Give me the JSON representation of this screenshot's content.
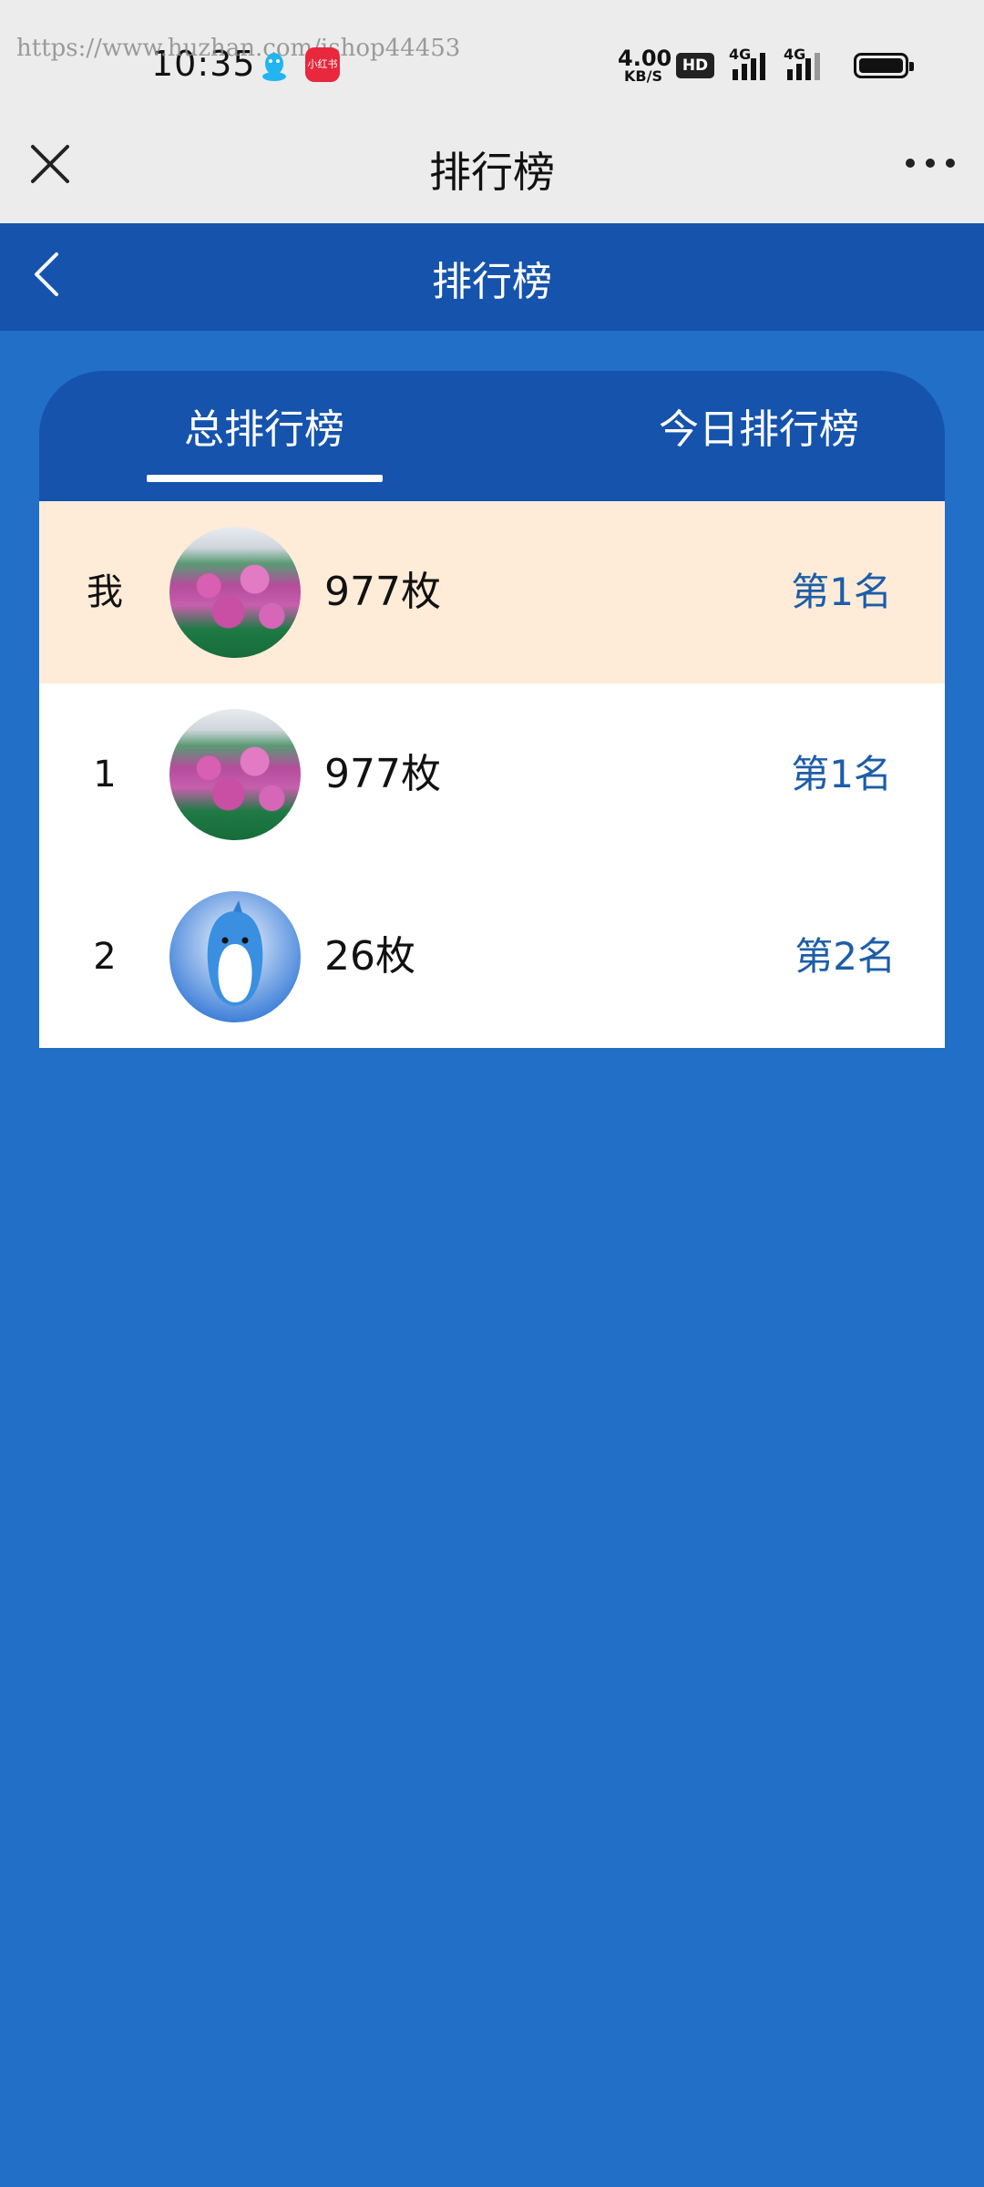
{
  "status_bar": {
    "time": "10:35",
    "watermark": "https://www.huzhan.com/ishop44453",
    "notification_badge": "小红书",
    "net_speed_value": "4.00",
    "net_speed_unit": "KB/S",
    "hd_label": "HD",
    "signal1_label": "4G",
    "signal2_label": "4G"
  },
  "wechat_bar": {
    "title": "排行榜"
  },
  "app_header": {
    "title": "排行榜"
  },
  "tabs": [
    {
      "label": "总排行榜",
      "active": true
    },
    {
      "label": "今日排行榜",
      "active": false
    }
  ],
  "rows": [
    {
      "rank": "我",
      "count": "977枚",
      "place": "第1名",
      "avatar": "flower-avatar",
      "highlight": true
    },
    {
      "rank": "1",
      "count": "977枚",
      "place": "第1名",
      "avatar": "flower-avatar",
      "highlight": false
    },
    {
      "rank": "2",
      "count": "26枚",
      "place": "第2名",
      "avatar": "dolphin-avatar",
      "highlight": false
    }
  ],
  "colors": {
    "page_background": "#216fc6",
    "header_background": "#1553ad",
    "highlight_row": "#ffecd8",
    "place_text": "#1d5da8"
  }
}
